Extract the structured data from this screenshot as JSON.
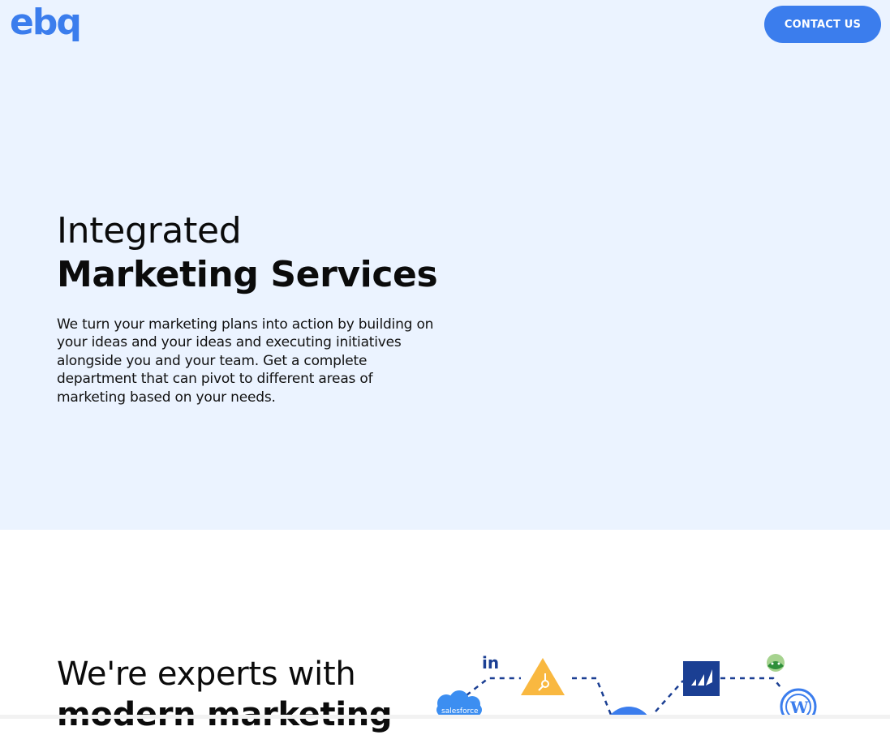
{
  "header": {
    "logo_text": "ebq",
    "contact_button_label": "CONTACT US"
  },
  "hero": {
    "title_line1": "Integrated",
    "title_line2": "Marketing Services",
    "description": "We turn your marketing plans into action by building on your ideas and your ideas and executing initiatives alongside you and your team. Get a complete department that can pivot to different areas of marketing based on your needs."
  },
  "experts_section": {
    "title_line1": "We're experts with",
    "title_line2": "modern marketing"
  },
  "integrations": {
    "icons": [
      "linkedin-icon",
      "hubspot-icon",
      "marketo-icon",
      "basecamp-icon",
      "salesforce-icon",
      "wordpress-icon",
      "center-hub-icon"
    ],
    "salesforce_label": "salesforce",
    "linkedin_label": "in"
  },
  "colors": {
    "accent": "#3b7ded",
    "hero_background": "#ebf3ff",
    "hubspot": "#f9b840",
    "marketo": "#1b3f93",
    "salesforce": "#3c8ef1",
    "linkedin": "#1b3f93"
  }
}
